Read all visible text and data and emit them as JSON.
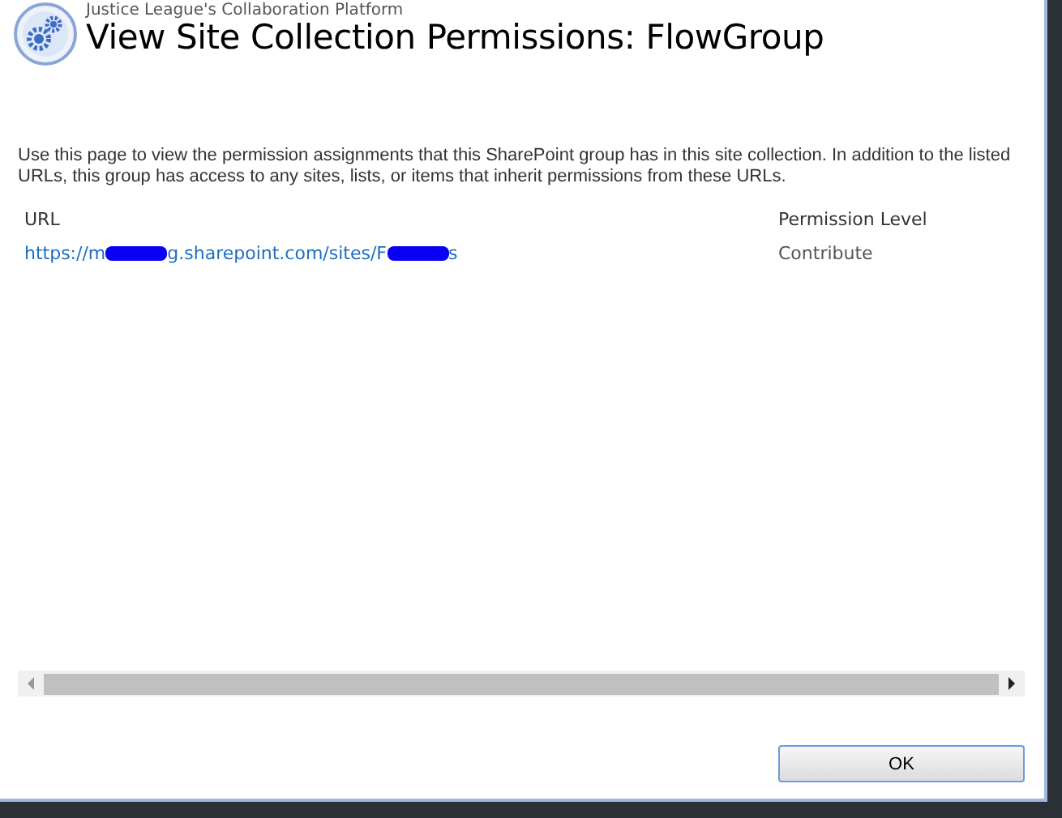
{
  "site_title": "Justice League's Collaboration Platform",
  "page_title": "View Site Collection Permissions: FlowGroup",
  "description": "Use this page to view the permission assignments that this SharePoint group has in this site collection. In addition to the listed URLs, this group has access to any sites, lists, or items that inherit permissions from these URLs.",
  "table": {
    "columns": [
      "URL",
      "Permission Level"
    ],
    "rows": [
      {
        "url_parts": [
          "https://m",
          "g.sharepoint.com/sites/F",
          "s"
        ],
        "permission": "Contribute"
      }
    ]
  },
  "buttons": [
    "OK"
  ]
}
